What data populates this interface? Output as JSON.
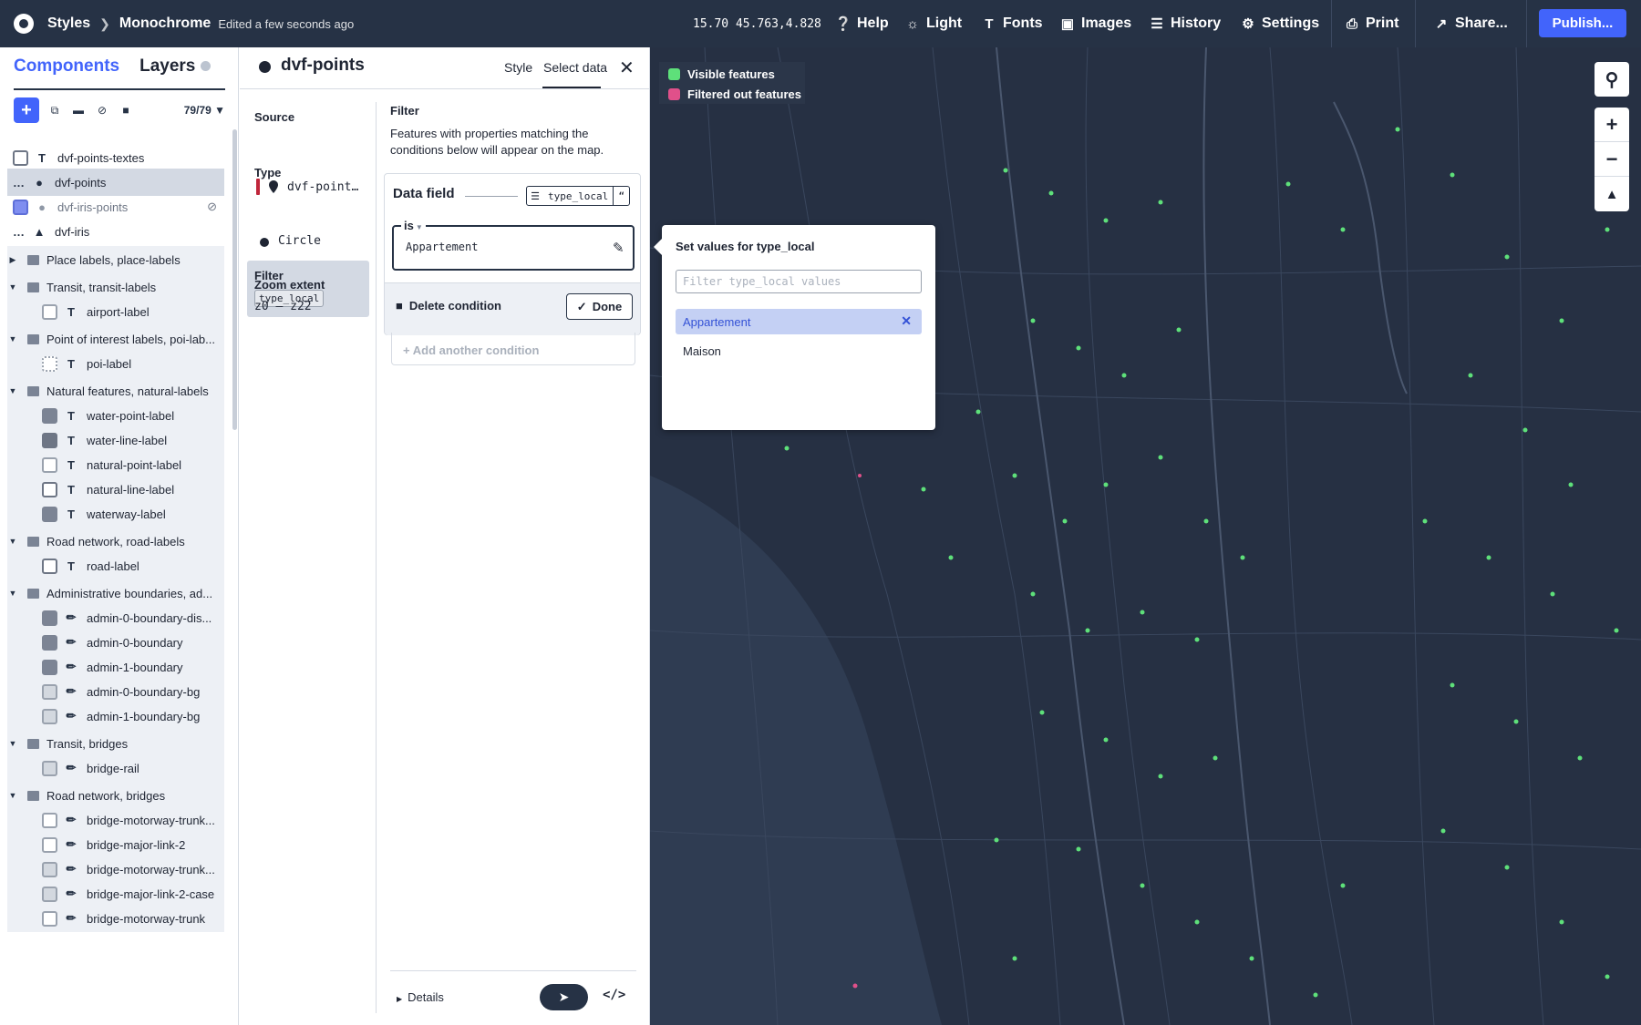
{
  "topbar": {
    "styles": "Styles",
    "style_name": "Monochrome",
    "edited": "Edited a few seconds ago",
    "coords": "15.70 45.763,4.828",
    "help": "Help",
    "light": "Light",
    "fonts": "Fonts",
    "images": "Images",
    "history": "History",
    "settings": "Settings",
    "print": "Print",
    "share": "Share...",
    "publish": "Publish..."
  },
  "layers_panel": {
    "tab_components": "Components",
    "tab_layers": "Layers",
    "count": "79/79",
    "rows": [
      {
        "label": "dvf-points-textes"
      },
      {
        "label": "dvf-points"
      },
      {
        "label": "dvf-iris-points"
      },
      {
        "label": "dvf-iris"
      },
      {
        "label": "Place labels, place-labels"
      },
      {
        "label": "Transit, transit-labels"
      },
      {
        "label": "airport-label"
      },
      {
        "label": "Point of interest labels, poi-lab..."
      },
      {
        "label": "poi-label"
      },
      {
        "label": "Natural features, natural-labels"
      },
      {
        "label": "water-point-label"
      },
      {
        "label": "water-line-label"
      },
      {
        "label": "natural-point-label"
      },
      {
        "label": "natural-line-label"
      },
      {
        "label": "waterway-label"
      },
      {
        "label": "Road network, road-labels"
      },
      {
        "label": "road-label"
      },
      {
        "label": "Administrative boundaries, ad..."
      },
      {
        "label": "admin-0-boundary-dis..."
      },
      {
        "label": "admin-0-boundary"
      },
      {
        "label": "admin-1-boundary"
      },
      {
        "label": "admin-0-boundary-bg"
      },
      {
        "label": "admin-1-boundary-bg"
      },
      {
        "label": "Transit, bridges"
      },
      {
        "label": "bridge-rail"
      },
      {
        "label": "Road network, bridges"
      },
      {
        "label": "bridge-motorway-trunk..."
      },
      {
        "label": "bridge-major-link-2"
      },
      {
        "label": "bridge-motorway-trunk..."
      },
      {
        "label": "bridge-major-link-2-case"
      },
      {
        "label": "bridge-motorway-trunk"
      }
    ]
  },
  "props": {
    "layer_name": "dvf-points",
    "tab_style": "Style",
    "tab_select": "Select data",
    "source_label": "Source",
    "source_value": "dvf-point…",
    "type_label": "Type",
    "type_value": "Circle",
    "filter_label": "Filter",
    "filter_tag": "type_local",
    "zoom_label": "Zoom extent",
    "zoom_value": "z0 — z22",
    "filter_heading": "Filter",
    "filter_desc": "Features with properties matching the conditions below will appear on the map.",
    "data_field": "Data field",
    "field_chip": "type_local",
    "operator": "is",
    "value": "Appartement",
    "delete": "Delete condition",
    "done": "Done",
    "add_condition": "Add another condition",
    "details": "Details"
  },
  "map": {
    "legend_visible": "Visible features",
    "legend_filtered": "Filtered out features",
    "visible_color": "#5ee07a",
    "filtered_color": "#e0508a"
  },
  "popover": {
    "title": "Set values for type_local",
    "placeholder": "Filter type_local values",
    "options": [
      {
        "label": "Appartement",
        "selected": true
      },
      {
        "label": "Maison",
        "selected": false
      }
    ]
  }
}
